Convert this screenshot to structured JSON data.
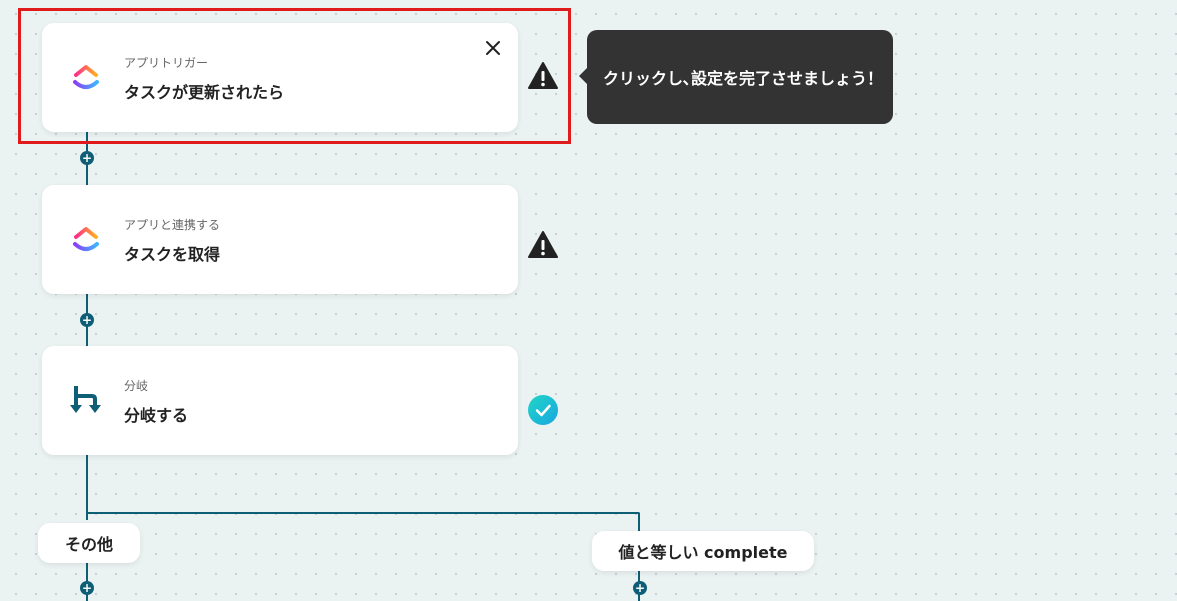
{
  "colors": {
    "accent": "#0e5f76",
    "highlight": "#e01b1b",
    "warning": "#222222",
    "success": "#1fc2d6",
    "tooltip_bg": "#333333"
  },
  "flow": {
    "steps": [
      {
        "subtitle": "アプリトリガー",
        "title": "タスクが更新されたら",
        "icon": "clickup-icon",
        "status": "warning-icon"
      },
      {
        "subtitle": "アプリと連携する",
        "title": "タスクを取得",
        "icon": "clickup-icon",
        "status": "warning-icon"
      },
      {
        "subtitle": "分岐",
        "title": "分岐する",
        "icon": "branch-icon",
        "status": "check-icon"
      }
    ],
    "branches": [
      {
        "label": "その他"
      },
      {
        "label": "値と等しい complete"
      }
    ]
  },
  "tooltip": {
    "text": "クリックし､設定を完了させましょう！"
  }
}
